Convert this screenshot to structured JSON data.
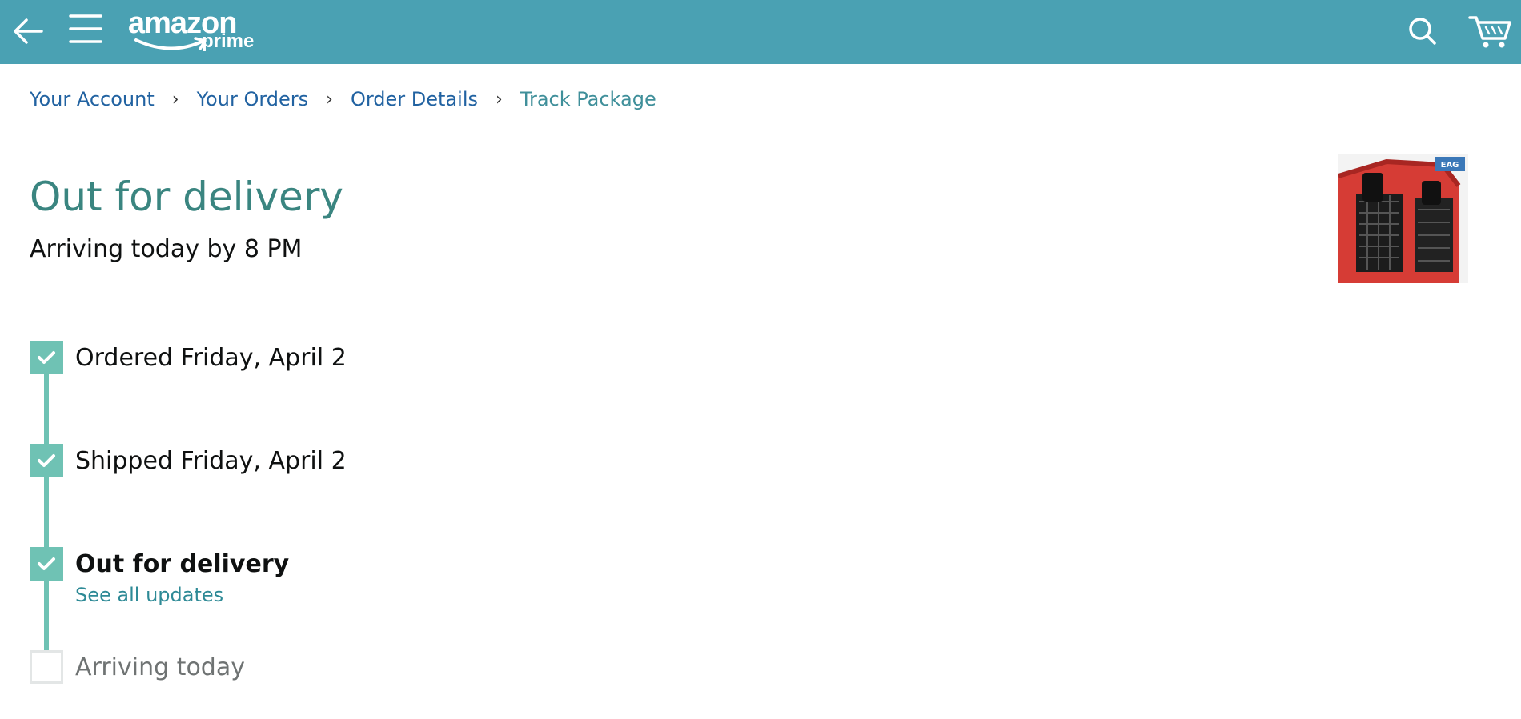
{
  "header": {
    "logo_text": "amazon",
    "logo_sub": "prime",
    "back_icon": "arrow-left-icon",
    "menu_icon": "hamburger-icon",
    "search_icon": "search-icon",
    "cart_icon": "cart-icon",
    "bar_color": "#4aa1b3"
  },
  "breadcrumb": {
    "items": [
      "Your Account",
      "Your Orders",
      "Order Details",
      "Track Package"
    ],
    "separator": "›"
  },
  "status": {
    "title": "Out for delivery",
    "subtitle": "Arriving today by 8 PM",
    "title_color": "#3a8580"
  },
  "timeline": {
    "steps": [
      {
        "label": "Ordered Friday, April 2",
        "done": true
      },
      {
        "label": "Shipped Friday, April 2",
        "done": true
      },
      {
        "label": "Out for delivery",
        "done": true,
        "link": "See all updates"
      },
      {
        "label": "Arriving today",
        "done": false
      }
    ],
    "accent_color": "#6fc2b4"
  },
  "product": {
    "image_icon": "product-thumbnail",
    "brand_badge": "EAG"
  }
}
